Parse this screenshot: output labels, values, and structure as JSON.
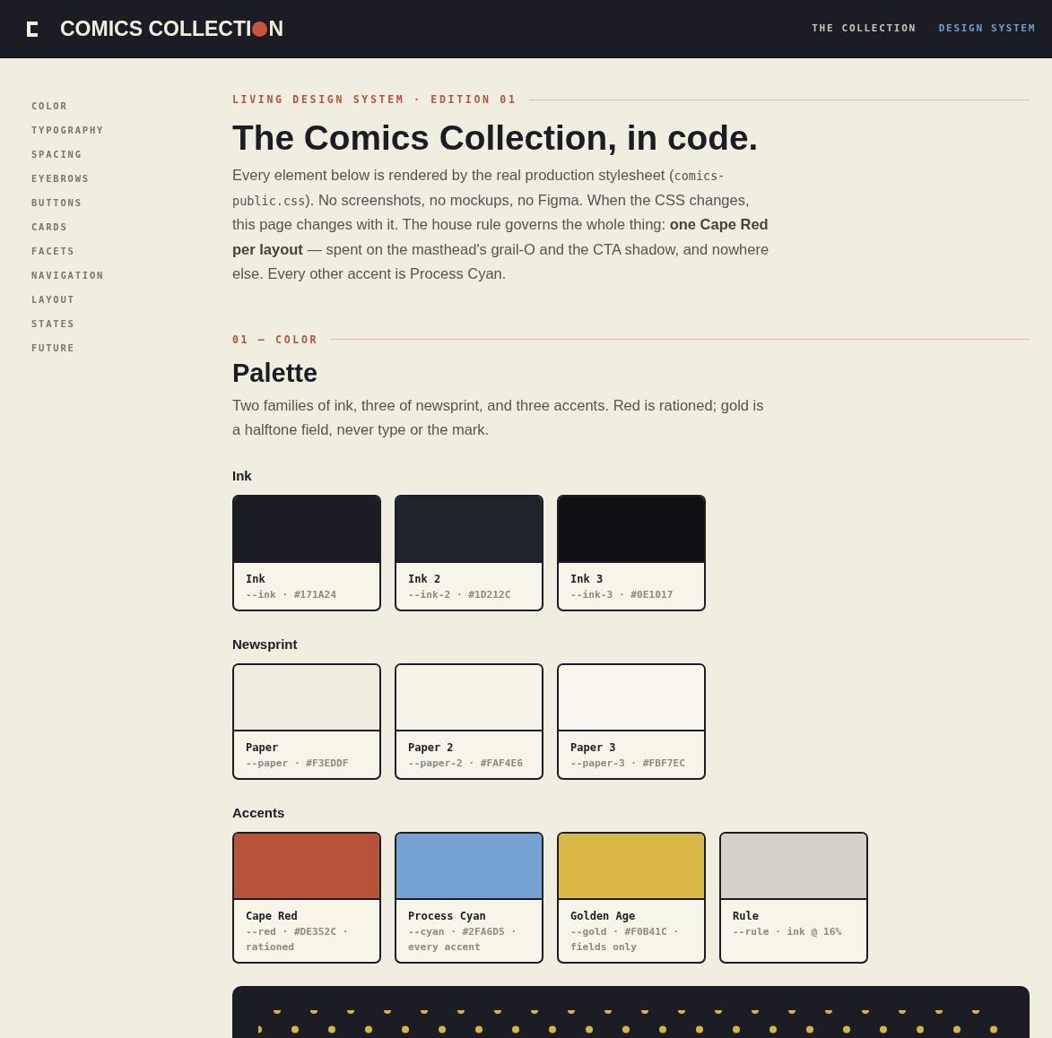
{
  "header": {
    "logo": {
      "wordmark_start": "COMICS COLLECTI",
      "wordmark_end": "N"
    },
    "nav": [
      {
        "label": "THE COLLECTION",
        "selected": false
      },
      {
        "label": "DESIGN SYSTEM",
        "selected": true
      }
    ]
  },
  "sidebar": {
    "items": [
      "COLOR",
      "TYPOGRAPHY",
      "SPACING",
      "EYEBROWS",
      "BUTTONS",
      "CARDS",
      "FACETS",
      "NAVIGATION",
      "LAYOUT",
      "STATES",
      "FUTURE"
    ]
  },
  "intro": {
    "eyebrow": "LIVING DESIGN SYSTEM · EDITION 01",
    "title": "The Comics Collection, in code.",
    "body": [
      {
        "kind": "text",
        "text": "Every element below is rendered by the real production stylesheet ("
      },
      {
        "kind": "code",
        "text": "comics-public.css"
      },
      {
        "kind": "text",
        "text": "). No screenshots, no mockups, no Figma. When the CSS changes, this page changes with it. The house rule governs the whole thing: **one Cape Red per layout** — spent on the masthead's grail-O and the CTA shadow, and nowhere else. Every other accent is Process Cyan."
      }
    ]
  },
  "section": {
    "eyebrow": "01 — COLOR",
    "title": "Palette",
    "description": "Two families of ink, three of newsprint, and three accents. Red is rationed; gold is a halftone field, never type or the mark.",
    "groups": [
      {
        "label": "Ink",
        "swatches": [
          {
            "name": "Ink",
            "meta": "--ink · #171A24",
            "color": "#1b1c24"
          },
          {
            "name": "Ink 2",
            "meta": "--ink-2 · #1D212C",
            "color": "#20232c"
          },
          {
            "name": "Ink 3",
            "meta": "--ink-3 · #0E1017",
            "color": "#0f1014"
          }
        ]
      },
      {
        "label": "Newsprint",
        "swatches": [
          {
            "name": "Paper",
            "meta": "--paper · #F3EDDF",
            "color": "#efece0"
          },
          {
            "name": "Paper 2",
            "meta": "--paper-2 · #FAF4E6",
            "color": "#f6f4e8"
          },
          {
            "name": "Paper 3",
            "meta": "--paper-3 · #FBF7EC",
            "color": "#f9f7ef"
          }
        ]
      },
      {
        "label": "Accents",
        "swatches": [
          {
            "name": "Cape Red",
            "meta": "--red · #DE352C · rationed",
            "color": "#b7533a"
          },
          {
            "name": "Process Cyan",
            "meta": "--cyan · #2FA6D5 · every accent",
            "color": "#75a2d2"
          },
          {
            "name": "Golden Age",
            "meta": "--gold · #F0B41C · fields only",
            "color": "#d9b848"
          },
          {
            "name": "Rule",
            "meta": "--rule · ink @ 16%",
            "color": "#d4d1c8"
          }
        ]
      }
    ]
  }
}
